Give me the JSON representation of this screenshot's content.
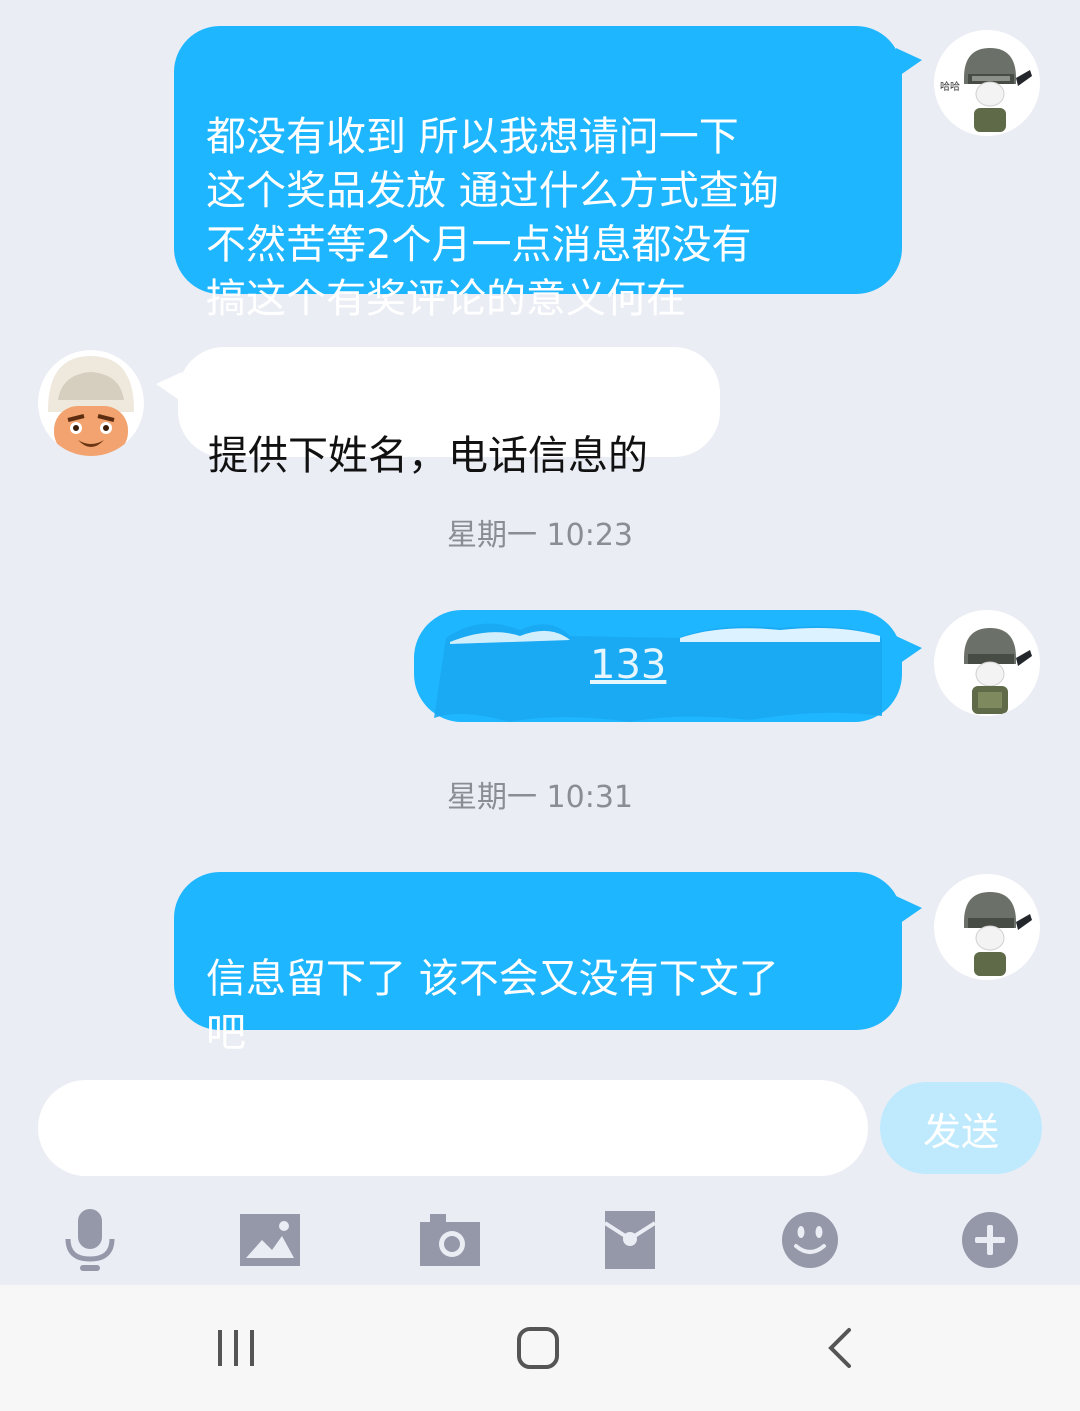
{
  "messages": [
    {
      "direction": "out",
      "text": "都没有收到   所以我想请问一下\n这个奖品发放   通过什么方式查询\n不然苦等2个月一点消息都没有\n搞这个有奖评论的意义何在"
    },
    {
      "direction": "in",
      "text": "提供下姓名，电话信息的"
    },
    {
      "direction": "out",
      "text": "133",
      "redacted": true
    },
    {
      "direction": "out",
      "text": "信息留下了   该不会又没有下文了\n吧"
    }
  ],
  "timestamps": [
    "星期一 10:23",
    "星期一 10:31"
  ],
  "avatar_text": "哈哈",
  "input": {
    "value": "",
    "placeholder": ""
  },
  "send_label": "发送",
  "toolbar": [
    "microphone-icon",
    "image-icon",
    "camera-icon",
    "red-packet-icon",
    "emoji-icon",
    "plus-icon"
  ],
  "colors": {
    "background": "#eaedf4",
    "outgoing_bubble": "#1eb6ff",
    "incoming_bubble": "#ffffff",
    "send_button": "#bfeafe",
    "toolbar_icon": "#9498a8"
  }
}
